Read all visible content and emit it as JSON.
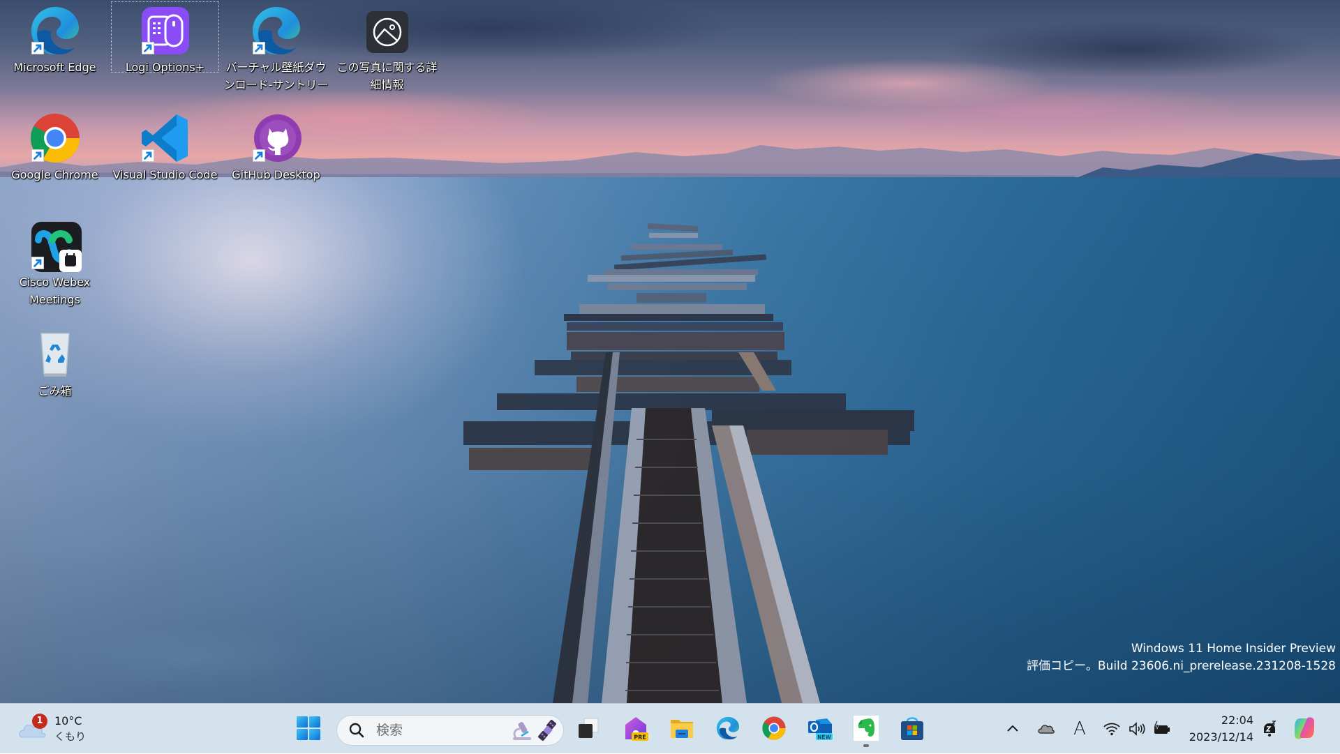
{
  "desktop": {
    "icons": [
      {
        "label": "Microsoft Edge",
        "icon": "edge-icon",
        "shortcut": true
      },
      {
        "label": "Logi Options+",
        "icon": "logi-options-icon",
        "shortcut": true,
        "selected": true
      },
      {
        "label": "バーチャル壁紙ダウンロード-サントリー",
        "icon": "edge-icon",
        "shortcut": true
      },
      {
        "label": "この写真に関する詳細情報",
        "icon": "photo-info-icon",
        "shortcut": false
      },
      {
        "label": "Google Chrome",
        "icon": "chrome-icon",
        "shortcut": true
      },
      {
        "label": "Visual Studio Code",
        "icon": "vscode-icon",
        "shortcut": true
      },
      {
        "label": "GitHub Desktop",
        "icon": "github-desktop-icon",
        "shortcut": true
      },
      {
        "label": "Cisco Webex Meetings",
        "icon": "webex-icon",
        "shortcut": true
      },
      {
        "label": "ごみ箱",
        "icon": "recycle-bin-icon",
        "shortcut": false
      }
    ]
  },
  "watermark": {
    "line1": "Windows 11 Home Insider Preview",
    "line2": "評価コピー。Build 23606.ni_prerelease.231208-1528"
  },
  "taskbar": {
    "weather": {
      "temp": "10°C",
      "condition": "くもり",
      "badge": "1"
    },
    "search": {
      "placeholder": "検索"
    },
    "pinned": [
      {
        "name": "start",
        "icon": "windows-start-icon"
      },
      {
        "name": "task-view",
        "icon": "task-view-icon"
      },
      {
        "name": "dev-home-preview",
        "icon": "dev-home-icon",
        "badge": "PRE"
      },
      {
        "name": "file-explorer",
        "icon": "folder-icon"
      },
      {
        "name": "microsoft-edge",
        "icon": "edge-icon"
      },
      {
        "name": "google-chrome",
        "icon": "chrome-icon"
      },
      {
        "name": "outlook-new",
        "icon": "outlook-icon",
        "badge": "NEW"
      },
      {
        "name": "evernote",
        "icon": "evernote-icon",
        "running": true
      },
      {
        "name": "microsoft-store",
        "icon": "store-icon"
      }
    ],
    "tray": {
      "clock_time": "22:04",
      "clock_date": "2023/12/14",
      "ime": "A"
    }
  },
  "colors": {
    "taskbar_bg": "#d3e2ec",
    "badge_red": "#c42b1c",
    "accent_blue": "#0078d4"
  }
}
